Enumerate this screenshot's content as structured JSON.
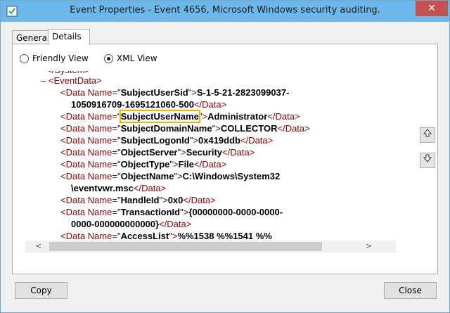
{
  "window": {
    "title": "Event Properties - Event 4656, Microsoft Windows security auditing.",
    "close_glyph": "✕"
  },
  "tabs": [
    {
      "label": "General"
    },
    {
      "label": "Details"
    }
  ],
  "view_options": {
    "friendly": "Friendly View",
    "xml": "XML View"
  },
  "xml": {
    "collapse_glyph": "–",
    "event_data_tag": "EventData",
    "lines": [
      {
        "name": "SubjectUserSid",
        "value": "S-1-5-21-2823099037-",
        "cont": "1050916709-1695121060-500"
      },
      {
        "name": "SubjectUserName",
        "value": "Administrator"
      },
      {
        "name": "SubjectDomainName",
        "value": "COLLECTOR"
      },
      {
        "name": "SubjectLogonId",
        "value": "0x419ddb"
      },
      {
        "name": "ObjectServer",
        "value": "Security"
      },
      {
        "name": "ObjectType",
        "value": "File"
      },
      {
        "name": "ObjectName",
        "value": "C:\\Windows\\System32",
        "cont": "\\eventvwr.msc"
      },
      {
        "name": "HandleId",
        "value": "0x0"
      },
      {
        "name": "TransactionId",
        "value": "{00000000-0000-0000-",
        "cont": "0000-000000000000}"
      },
      {
        "name": "AccessList",
        "value": "%%1538 %%1541 %%"
      }
    ]
  },
  "buttons": {
    "copy": "Copy",
    "close": "Close"
  }
}
